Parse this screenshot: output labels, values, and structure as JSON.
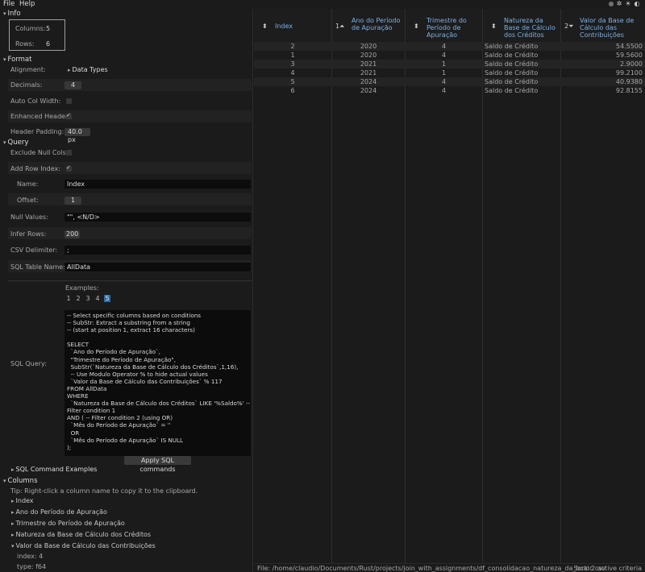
{
  "menu": {
    "file": "File",
    "help": "Help"
  },
  "window_controls": {
    "dot": "●",
    "gear": "✲",
    "theme": "☀",
    "moon": "◐"
  },
  "info": {
    "header": "Info",
    "columns_label": "Columns:",
    "columns_value": "5",
    "rows_label": "Rows:",
    "rows_value": "6"
  },
  "format": {
    "header": "Format",
    "alignment_label": "Alignment:",
    "alignment_value": "Data Types",
    "decimals_label": "Decimals:",
    "decimals_value": "4",
    "auto_col_width_label": "Auto Col Width:",
    "auto_col_width_checked": false,
    "enhanced_header_label": "Enhanced Header:",
    "enhanced_header_checked": true,
    "header_padding_label": "Header Padding:",
    "header_padding_value": "40.0 px"
  },
  "query": {
    "header": "Query",
    "exclude_null_label": "Exclude Null Cols:",
    "exclude_null_checked": false,
    "add_row_index_label": "Add Row Index:",
    "add_row_index_checked": true,
    "name_label": "Name:",
    "name_value": "Index",
    "offset_label": "Offset:",
    "offset_value": "1",
    "null_values_label": "Null Values:",
    "null_values_value": "\"\", <N/D>",
    "infer_rows_label": "Infer Rows:",
    "infer_rows_value": "200",
    "csv_delim_label": "CSV Delimiter:",
    "csv_delim_value": ";",
    "sql_table_label": "SQL Table Name:",
    "sql_table_value": "AllData",
    "examples_label": "Examples:",
    "examples": [
      "1",
      "2",
      "3",
      "4",
      "5"
    ],
    "selected_example": "5",
    "sql_query_label": "SQL Query:",
    "sql_text": "-- Select specific columns based on conditions\n-- SubStr: Extract a substring from a string\n-- (start at position 1, extract 16 characters)\n\nSELECT\n  `Ano do Período de Apuração`,\n  \"Trimestre do Período de Apuração\",\n  SubStr(`Natureza da Base de Cálculo dos Créditos`,1,16),\n  -- Use Modulo Operator % to hide actual values\n  `Valor da Base de Cálculo das Contribuições` % 117\nFROM AllData\nWHERE\n  `Natureza da Base de Cálculo dos Créditos` LIKE '%Saldo%' --\nFilter condition 1\nAND ( -- Filter condition 2 (using OR)\n  `Mês do Período de Apuração` = ''\n  OR\n  `Mês do Período de Apuração` IS NULL\n);",
    "apply_button": "Apply SQL commands",
    "sql_examples_header": "SQL Command Examples"
  },
  "columns_section": {
    "header": "Columns",
    "tip": "Tip: Right-click a column name to copy it to the clipboard.",
    "items": [
      "Index",
      "Ano do Período de Apuração",
      "Trimestre do Período de Apuração",
      "Natureza da Base de Cálculo dos Créditos",
      "Valor da Base de Cálculo das Contribuições"
    ],
    "expanded_index_label": "index: 4",
    "expanded_type_label": "type: f64"
  },
  "table": {
    "headers": [
      {
        "label": "Index",
        "sort": "⬍"
      },
      {
        "label": "Ano do Período de Apuração",
        "sort": "1⏶"
      },
      {
        "label": "Trimestre do Período de Apuração",
        "sort": "⬍"
      },
      {
        "label": "Natureza da Base de Cálculo dos Créditos",
        "sort": "⬍"
      },
      {
        "label": "Valor da Base de Cálculo das Contribuições",
        "sort": "2⏷"
      }
    ],
    "rows": [
      [
        "2",
        "2020",
        "4",
        "Saldo de Crédito",
        "54.5500"
      ],
      [
        "1",
        "2020",
        "4",
        "Saldo de Crédito",
        "59.5600"
      ],
      [
        "3",
        "2021",
        "1",
        "Saldo de Crédito",
        "2.9000"
      ],
      [
        "4",
        "2021",
        "1",
        "Saldo de Crédito",
        "99.2100"
      ],
      [
        "5",
        "2024",
        "4",
        "Saldo de Crédito",
        "40.9380"
      ],
      [
        "6",
        "2024",
        "4",
        "Saldo de Crédito",
        "92.8155"
      ]
    ]
  },
  "status": {
    "file": "File: /home/claudio/Documents/Rust/projects/join_with_assignments/df_consolidacao_natureza_da_bcalc.csv",
    "sort": "Sort: 2 active criteria"
  }
}
